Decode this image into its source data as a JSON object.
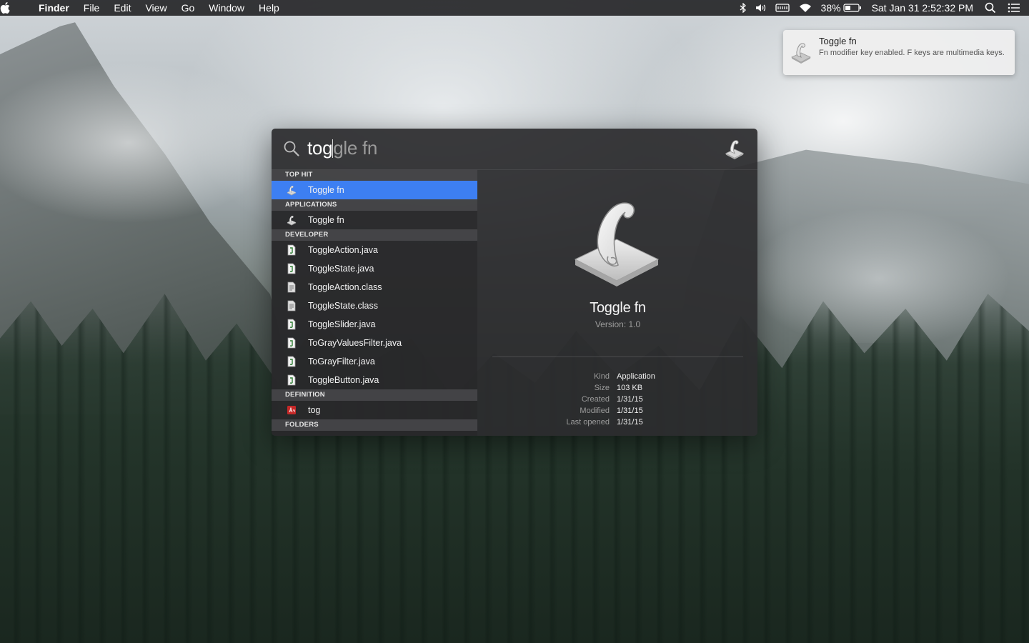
{
  "menubar": {
    "app_name": "Finder",
    "menus": [
      "File",
      "Edit",
      "View",
      "Go",
      "Window",
      "Help"
    ],
    "battery_percent": "38%",
    "datetime": "Sat Jan 31  2:52:32 PM",
    "icons": [
      "apple-icon",
      "bluetooth-icon",
      "volume-icon",
      "keyboard-icon",
      "wifi-icon",
      "battery-icon",
      "spotlight-search-icon",
      "notification-center-icon"
    ]
  },
  "notification": {
    "title": "Toggle fn",
    "body": "Fn modifier key enabled. F keys are multimedia keys.",
    "icon": "script-app-icon"
  },
  "spotlight": {
    "query_typed": "tog",
    "query_completion": "gle fn",
    "sections": [
      {
        "header": "TOP HIT",
        "items": [
          {
            "label": "Toggle fn",
            "icon": "script-app-icon",
            "selected": true
          }
        ]
      },
      {
        "header": "APPLICATIONS",
        "items": [
          {
            "label": "Toggle fn",
            "icon": "script-app-icon"
          }
        ]
      },
      {
        "header": "DEVELOPER",
        "items": [
          {
            "label": "ToggleAction.java",
            "icon": "java-file-icon"
          },
          {
            "label": "ToggleState.java",
            "icon": "java-file-icon"
          },
          {
            "label": "ToggleAction.class",
            "icon": "class-file-icon"
          },
          {
            "label": "ToggleState.class",
            "icon": "class-file-icon"
          },
          {
            "label": "ToggleSlider.java",
            "icon": "java-file-icon"
          },
          {
            "label": "ToGrayValuesFilter.java",
            "icon": "java-file-icon"
          },
          {
            "label": "ToGrayFilter.java",
            "icon": "java-file-icon"
          },
          {
            "label": "ToggleButton.java",
            "icon": "java-file-icon"
          }
        ]
      },
      {
        "header": "DEFINITION",
        "items": [
          {
            "label": "tog",
            "icon": "dictionary-icon"
          }
        ]
      },
      {
        "header": "FOLDERS",
        "items": []
      }
    ],
    "preview": {
      "name": "Toggle fn",
      "version": "Version: 1.0",
      "metadata": [
        {
          "key": "Kind",
          "value": "Application"
        },
        {
          "key": "Size",
          "value": "103 KB"
        },
        {
          "key": "Created",
          "value": "1/31/15"
        },
        {
          "key": "Modified",
          "value": "1/31/15"
        },
        {
          "key": "Last opened",
          "value": "1/31/15"
        }
      ]
    }
  },
  "colors": {
    "selection": "#3d7ff2",
    "spotlight_bg": "#2c2c2e",
    "menubar_bg": "#1e1e20"
  }
}
